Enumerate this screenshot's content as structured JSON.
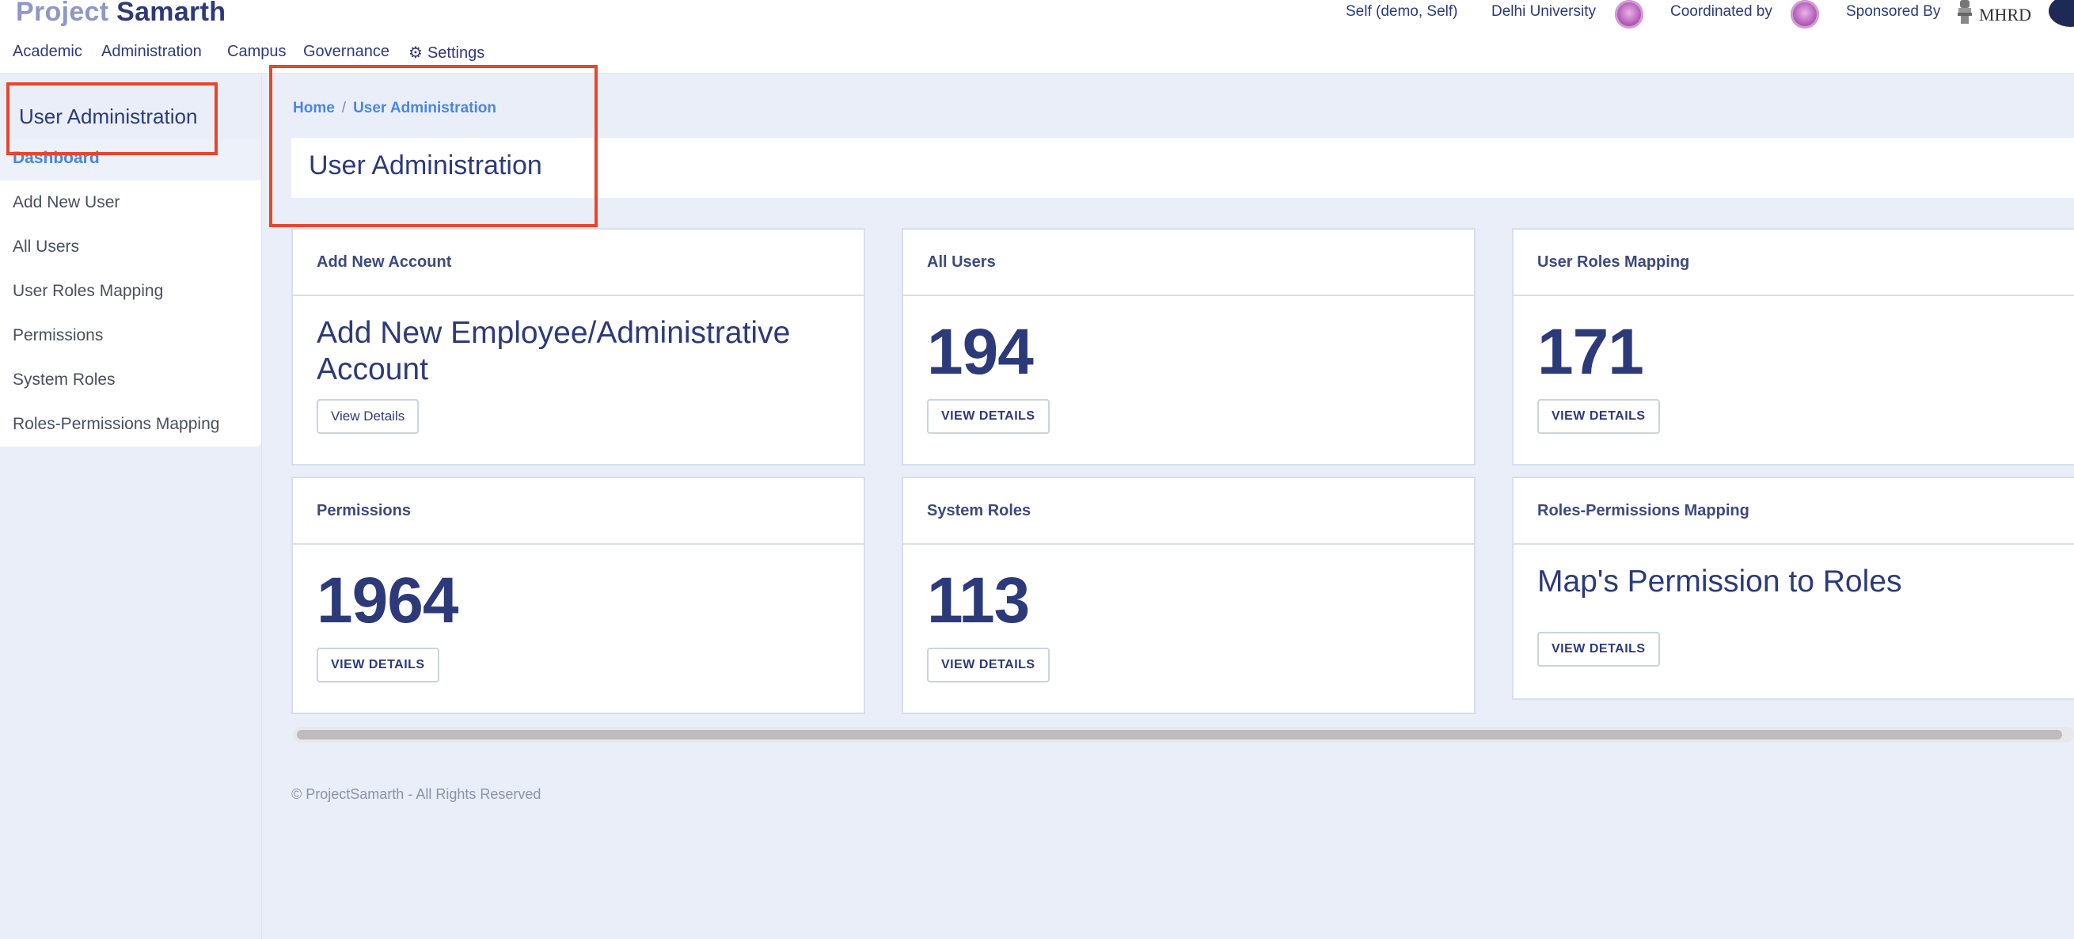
{
  "brand": {
    "part1": "Project",
    "part2": "Samarth"
  },
  "header": {
    "user": "Self (demo, Self)",
    "university": "Delhi University",
    "coordinated_by": "Coordinated by",
    "sponsored_by": "Sponsored By",
    "sponsor_logo_text": "MHRD"
  },
  "nav": {
    "items": [
      "Academic",
      "Administration",
      "Campus",
      "Governance",
      "Settings"
    ],
    "settings_icon": "gear-icon"
  },
  "sidebar": {
    "title": "User Administration",
    "items": [
      {
        "label": "Dashboard",
        "active": true
      },
      {
        "label": "Add New User",
        "active": false
      },
      {
        "label": "All Users",
        "active": false
      },
      {
        "label": "User Roles Mapping",
        "active": false
      },
      {
        "label": "Permissions",
        "active": false
      },
      {
        "label": "System Roles",
        "active": false
      },
      {
        "label": "Roles-Permissions Mapping",
        "active": false
      }
    ]
  },
  "breadcrumb": {
    "home": "Home",
    "separator": "/",
    "current": "User Administration"
  },
  "page": {
    "title": "User Administration"
  },
  "cards": [
    {
      "header": "Add New Account",
      "text": "Add New Employee/Administrative Account",
      "button": "View Details"
    },
    {
      "header": "All Users",
      "value": "194",
      "button": "VIEW DETAILS"
    },
    {
      "header": "User Roles Mapping",
      "value": "171",
      "button": "VIEW DETAILS"
    },
    {
      "header": "Permissions",
      "value": "1964",
      "button": "VIEW DETAILS"
    },
    {
      "header": "System Roles",
      "value": "113",
      "button": "VIEW DETAILS"
    },
    {
      "header": "Roles-Permissions Mapping",
      "text": "Map's Permission to Roles",
      "button": "VIEW DETAILS"
    }
  ],
  "footer": {
    "text": "© ProjectSamarth - All Rights Reserved"
  },
  "colors": {
    "primary": "#2d3a7a",
    "link": "#4a86e0",
    "background": "#eaeef8",
    "annotation": "#e8452b"
  }
}
